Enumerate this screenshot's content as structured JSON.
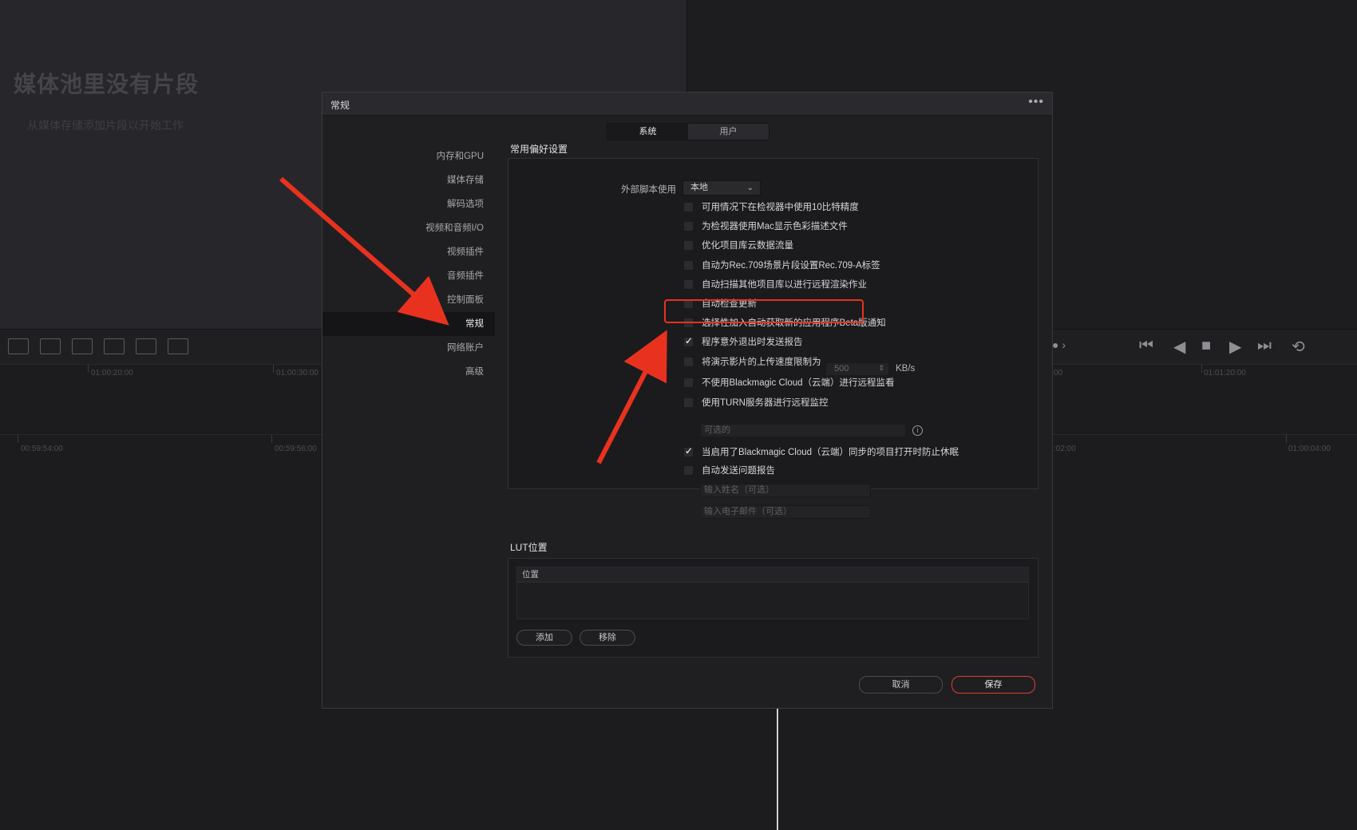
{
  "background": {
    "media_pool_empty_title": "媒体池里没有片段",
    "media_pool_empty_hint": "从媒体存储添加片段以开始工作",
    "timeline_ruler_top": [
      "01:00:20:00",
      "01:00:30:00",
      "00",
      "01:01:20:00"
    ],
    "timeline_ruler_bottom": [
      "00:59:54:00",
      "00:59:56:00",
      ":02:00",
      "01:00:04:00"
    ],
    "edit_toolbar_icons": [
      "insert-clip-icon",
      "overwrite-clip-icon",
      "replace-clip-icon",
      "fit-to-fill-icon",
      "place-on-top-icon",
      "ripple-overwrite-icon"
    ],
    "transport_icons": [
      "go-to-start-icon",
      "play-reverse-icon",
      "stop-icon",
      "play-icon",
      "go-to-end-icon",
      "loop-icon"
    ]
  },
  "dialog": {
    "title": "常规",
    "more_icon": "•••",
    "tabs": [
      {
        "label": "系统",
        "active": true
      },
      {
        "label": "用户",
        "active": false
      }
    ],
    "nav_items": [
      {
        "label": "内存和GPU",
        "active": false
      },
      {
        "label": "媒体存储",
        "active": false
      },
      {
        "label": "解码选项",
        "active": false
      },
      {
        "label": "视频和音频I/O",
        "active": false
      },
      {
        "label": "视频插件",
        "active": false
      },
      {
        "label": "音频插件",
        "active": false
      },
      {
        "label": "控制面板",
        "active": false
      },
      {
        "label": "常规",
        "active": true
      },
      {
        "label": "网络账户",
        "active": false
      },
      {
        "label": "高级",
        "active": false
      }
    ],
    "general_prefs": {
      "section_title": "常用偏好设置",
      "external_script_label": "外部脚本使用",
      "external_script_value": "本地",
      "options": [
        {
          "label": "可用情况下在检视器中使用10比特精度",
          "checked": false
        },
        {
          "label": "为检视器使用Mac显示色彩描述文件",
          "checked": false
        },
        {
          "label": "优化项目库云数据流量",
          "checked": false
        },
        {
          "label": "自动为Rec.709场景片段设置Rec.709-A标签",
          "checked": false
        },
        {
          "label": "自动扫描其他项目库以进行远程渲染作业",
          "checked": false
        },
        {
          "label": "自动检查更新",
          "checked": false
        },
        {
          "label": "选择性加入自动获取新的应用程序Beta版通知",
          "checked": false
        },
        {
          "label": "程序意外退出时发送报告",
          "checked": true
        },
        {
          "label": "将演示影片的上传速度限制为",
          "checked": false
        },
        {
          "label": "不使用Blackmagic Cloud（云端）进行远程监看",
          "checked": false
        },
        {
          "label": "使用TURN服务器进行远程监控",
          "checked": false
        },
        {
          "label": "当启用了Blackmagic Cloud（云端）同步的项目打开时防止休眠",
          "checked": true
        },
        {
          "label": "自动发送问题报告",
          "checked": false
        }
      ],
      "upload_speed_value": "500",
      "upload_speed_unit": "KB/s",
      "turn_server_placeholder": "可选的",
      "name_placeholder": "输入姓名（可选）",
      "email_placeholder": "输入电子邮件（可选）"
    },
    "lut": {
      "section_title": "LUT位置",
      "column_header": "位置",
      "add_label": "添加",
      "remove_label": "移除"
    },
    "cancel_label": "取消",
    "save_label": "保存"
  },
  "annotations": {
    "accent_color": "#e8321f",
    "highlighted_option": "自动检查更新"
  }
}
